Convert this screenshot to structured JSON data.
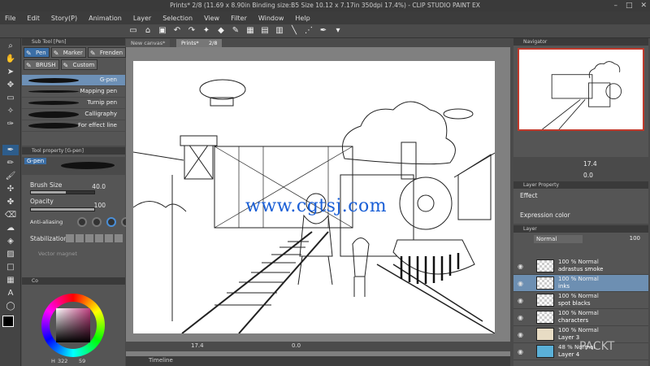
{
  "window": {
    "title": "Prints* 2/8 (11.69 x 8.90in Binding size:B5 Size 10.12 x 7.17in 350dpi 17.4%) - CLIP STUDIO PAINT EX"
  },
  "menu": [
    "File",
    "Edit",
    "Story(P)",
    "Animation",
    "Layer",
    "Selection",
    "View",
    "Filter",
    "Window",
    "Help"
  ],
  "sub_tool": {
    "header": "Sub Tool [Pen]",
    "tabs": [
      "Pen",
      "Marker",
      "Frenden",
      "BRUSH",
      "Custom"
    ],
    "brushes": [
      "G-pen",
      "Mapping pen",
      "Turnip pen",
      "Calligraphy",
      "For effect line"
    ]
  },
  "tool_property": {
    "header": "Tool property [G-pen]",
    "name": "G-pen",
    "brush_size_label": "Brush Size",
    "brush_size_value": "40.0",
    "opacity_label": "Opacity",
    "opacity_value": "100",
    "antialiasing_label": "Anti-aliasing",
    "stabilization_label": "Stabilization",
    "vector_magnet_label": "Vector magnet"
  },
  "color": {
    "header": "Co",
    "h_label": "H",
    "h_value": "322",
    "s_value": "59"
  },
  "canvas": {
    "tabs": [
      "New canvas*",
      "Prints*",
      "2/8"
    ],
    "zoom": "17.4",
    "angle": "0.0",
    "timeline_label": "Timeline",
    "watermark": "www.cgtsj.com"
  },
  "navigator": {
    "header": "Navigator",
    "zoom": "17.4",
    "angle": "0.0"
  },
  "layer_property": {
    "header": "Layer Property",
    "effect_label": "Effect",
    "expression_color_label": "Expression color"
  },
  "layers": {
    "header": "Layer",
    "blend_mode": "Normal",
    "opacity": "100",
    "items": [
      {
        "mode": "100 %  Normal",
        "name": "adrastus smoke",
        "active": false
      },
      {
        "mode": "100 %  Normal",
        "name": "inks",
        "active": true
      },
      {
        "mode": "100 %  Normal",
        "name": "spot blacks",
        "active": false
      },
      {
        "mode": "100 %  Normal",
        "name": "characters",
        "active": false
      },
      {
        "mode": "100 %  Normal",
        "name": "Layer 3",
        "active": false
      },
      {
        "mode": "48 %  Normal",
        "name": "Layer 4",
        "active": false
      }
    ]
  },
  "branding": "PACKT"
}
